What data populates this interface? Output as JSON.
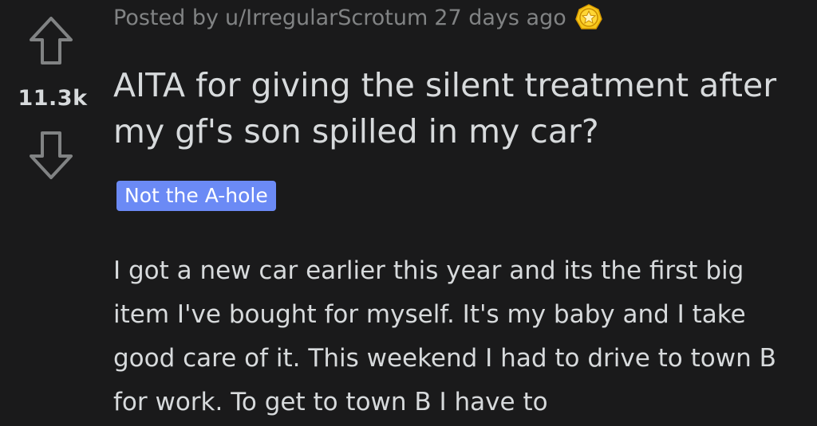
{
  "post": {
    "score": "11.3k",
    "meta": {
      "prefix": "Posted by",
      "author": "u/IrregularScrotum",
      "age": "27 days ago"
    },
    "award": {
      "icon": "award-icon",
      "color": "#f5c71a"
    },
    "title": "AITA for giving the silent treatment after my gf's son spilled in my car?",
    "flair": {
      "label": "Not the A-hole",
      "color": "#6b8af5"
    },
    "body": "I got a new car earlier this year and its the first big item I've bought for myself. It's my baby and I take good care of it. This weekend I had to drive to town B for work. To get to town B I have to"
  },
  "icons": {
    "upvote": "upvote-arrow-icon",
    "downvote": "downvote-arrow-icon"
  }
}
